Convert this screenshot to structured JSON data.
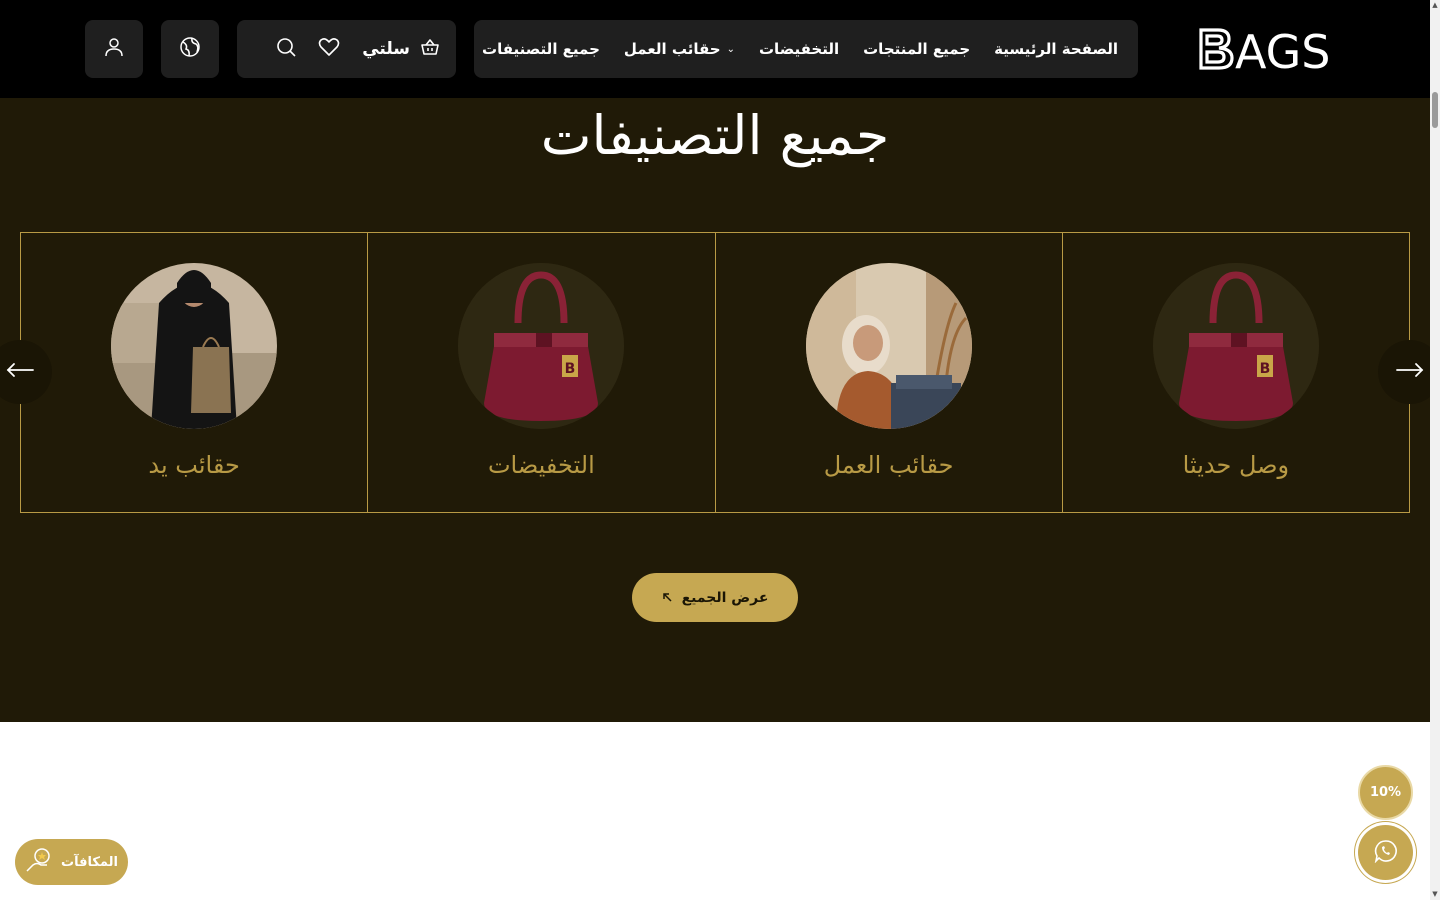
{
  "header": {
    "logo_text": "BAGS",
    "nav": [
      {
        "label": "الصفحة الرئيسية"
      },
      {
        "label": "جميع المنتجات"
      },
      {
        "label": "التخفيضات"
      },
      {
        "label": "حقائب العمل",
        "has_dropdown": true
      },
      {
        "label": "جميع التصنيفات"
      }
    ],
    "cart_label": "سلتي",
    "icons": [
      "basket-icon",
      "heart-icon",
      "search-icon",
      "globe-icon",
      "user-icon"
    ]
  },
  "section": {
    "title": "جميع التصنيفات",
    "categories": [
      {
        "label": "وصل حديثا",
        "image": "burgundy-handbag"
      },
      {
        "label": "حقائب العمل",
        "image": "woman-with-work-bag"
      },
      {
        "label": "التخفيضات",
        "image": "burgundy-handbag"
      },
      {
        "label": "حقائب يد",
        "image": "woman-holding-tote"
      }
    ],
    "view_all_label": "عرض الجميع"
  },
  "floating": {
    "discount_badge": "10%",
    "rewards_label": "المكافآت"
  },
  "colors": {
    "header_bg": "#000000",
    "section_bg": "#201a07",
    "accent_gold": "#c6a852",
    "card_border": "#b89a45"
  }
}
